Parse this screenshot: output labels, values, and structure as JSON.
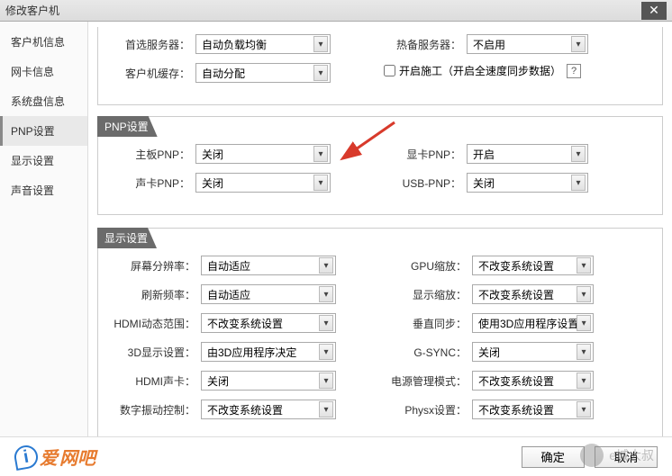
{
  "window": {
    "title": "修改客户机"
  },
  "sidebar": {
    "items": [
      {
        "label": "客户机信息"
      },
      {
        "label": "网卡信息"
      },
      {
        "label": "系统盘信息"
      },
      {
        "label": "PNP设置"
      },
      {
        "label": "显示设置"
      },
      {
        "label": "声音设置"
      }
    ]
  },
  "top": {
    "preferred_server_label": "首选服务器：",
    "preferred_server_value": "自动负载均衡",
    "backup_server_label": "热备服务器：",
    "backup_server_value": "不启用",
    "client_cache_label": "客户机缓存：",
    "client_cache_value": "自动分配",
    "construction_label": "开启施工（开启全速度同步数据）",
    "help": "?"
  },
  "pnp": {
    "legend": "PNP设置",
    "mb_label": "主板PNP：",
    "mb_value": "关闭",
    "gpu_label": "显卡PNP：",
    "gpu_value": "开启",
    "snd_label": "声卡PNP：",
    "snd_value": "关闭",
    "usb_label": "USB-PNP：",
    "usb_value": "关闭"
  },
  "display": {
    "legend": "显示设置",
    "res_label": "屏幕分辨率：",
    "res_value": "自动适应",
    "gpu_scale_label": "GPU缩放：",
    "gpu_scale_value": "不改变系统设置",
    "refresh_label": "刷新频率：",
    "refresh_value": "自动适应",
    "disp_scale_label": "显示缩放：",
    "disp_scale_value": "不改变系统设置",
    "hdmi_range_label": "HDMI动态范围：",
    "hdmi_range_value": "不改变系统设置",
    "vsync_label": "垂直同步：",
    "vsync_value": "使用3D应用程序设置",
    "d3d_label": "3D显示设置：",
    "d3d_value": "由3D应用程序决定",
    "gsync_label": "G-SYNC：",
    "gsync_value": "关闭",
    "hdmi_snd_label": "HDMI声卡：",
    "hdmi_snd_value": "关闭",
    "power_label": "电源管理模式：",
    "power_value": "不改变系统设置",
    "vib_label": "数字振动控制：",
    "vib_value": "不改变系统设置",
    "physx_label": "Physx设置：",
    "physx_value": "不改变系统设置"
  },
  "footer": {
    "logo1": "爱",
    "logo2": "网吧",
    "ok": "确定",
    "cancel": "取消"
  },
  "watermark": {
    "text": "e城大叔"
  }
}
